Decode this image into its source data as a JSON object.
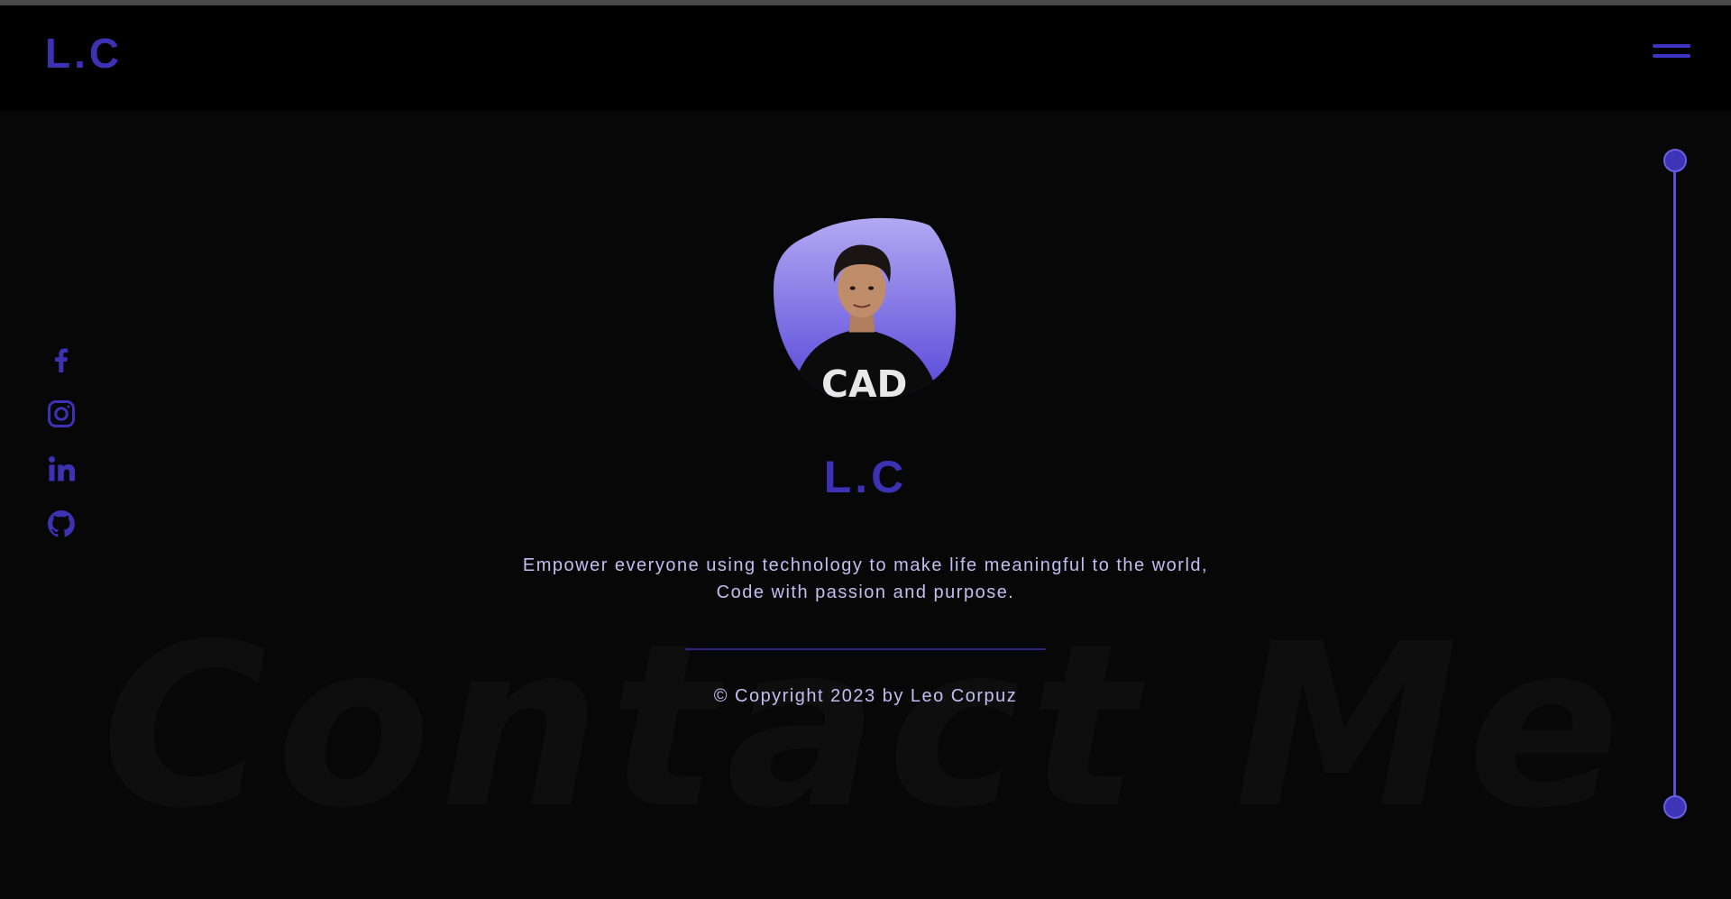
{
  "header": {
    "logo": "L.C",
    "menu_icon": "hamburger-menu-icon"
  },
  "socials": [
    {
      "name": "facebook",
      "icon": "facebook-icon"
    },
    {
      "name": "instagram",
      "icon": "instagram-icon"
    },
    {
      "name": "linkedin",
      "icon": "linkedin-icon"
    },
    {
      "name": "github",
      "icon": "github-icon"
    }
  ],
  "main": {
    "name": "L.C",
    "tagline_line1": "Empower everyone using technology to make life meaningful to the world,",
    "tagline_line2": "Code with passion and purpose.",
    "copyright": "© Copyright 2023 by Leo Corpuz",
    "background_text": "Contact Me"
  },
  "colors": {
    "accent": "#3d31b4",
    "accent_light": "#5a4fd6",
    "text": "#c3bdf0",
    "background": "#070707",
    "header_bg": "#000000"
  }
}
